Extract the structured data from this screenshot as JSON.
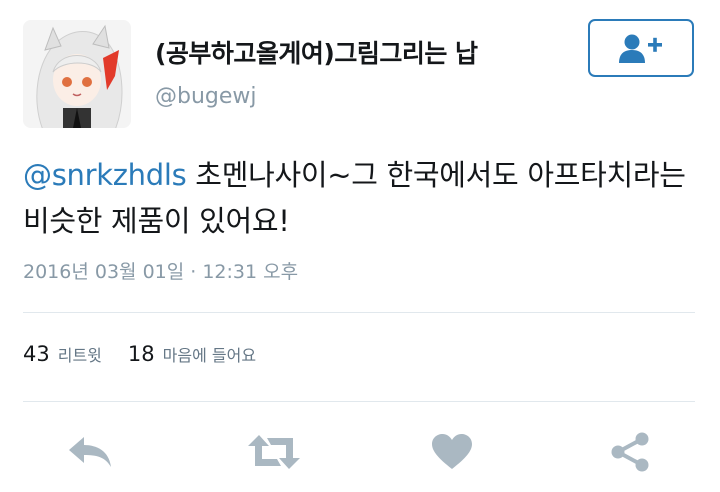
{
  "user": {
    "display_name": "(공부하고올게여)그림그리는 납",
    "handle": "@bugewj"
  },
  "tweet": {
    "mention": "@snrkzhdls",
    "text": " 초멘나사이~그 한국에서도 아프타치라는 비슷한 제품이 있어요!",
    "timestamp": "2016년 03월 01일 · 12:31 오후"
  },
  "stats": {
    "retweets_count": "43",
    "retweets_label": "리트윗",
    "likes_count": "18",
    "likes_label": "마음에 들어요"
  },
  "icons": {
    "follow": "person-plus-icon",
    "reply": "reply-icon",
    "retweet": "retweet-icon",
    "like": "heart-icon",
    "share": "share-icon"
  },
  "colors": {
    "accent": "#2b7bb9",
    "secondary_text": "#8899a6",
    "action_icon": "#aab8c2",
    "divider": "#e1e8ed"
  }
}
